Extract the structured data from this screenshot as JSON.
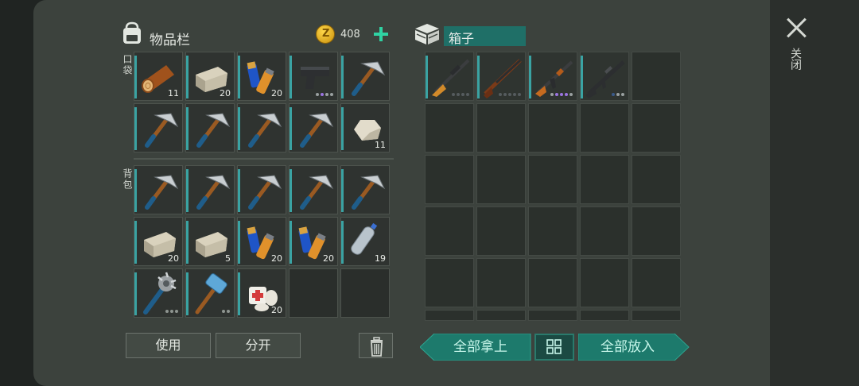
{
  "header": {
    "inventory_title": "物品栏",
    "coin_count": "408",
    "box_title": "箱子"
  },
  "labels": {
    "pocket": "口袋",
    "backpack": "背包",
    "close": "关闭"
  },
  "buttons": {
    "use": "使用",
    "split": "分开",
    "take_all": "全部拿上",
    "put_all": "全部放入"
  },
  "pocket": [
    {
      "item": "log",
      "count": "11"
    },
    {
      "item": "stone-block",
      "count": "20"
    },
    {
      "item": "batteries",
      "count": "20"
    },
    {
      "item": "pistol",
      "count": "",
      "rarity": [
        "#9aa0a0",
        "#9b74e0",
        "#9aa0a0",
        "#9aa0a0"
      ]
    },
    {
      "item": "pickaxe",
      "count": ""
    },
    {
      "item": "pickaxe",
      "count": ""
    },
    {
      "item": "pickaxe",
      "count": ""
    },
    {
      "item": "pickaxe",
      "count": ""
    },
    {
      "item": "pickaxe",
      "count": ""
    },
    {
      "item": "rock",
      "count": "11"
    }
  ],
  "backpack": [
    {
      "item": "pickaxe",
      "count": ""
    },
    {
      "item": "pickaxe",
      "count": ""
    },
    {
      "item": "pickaxe",
      "count": ""
    },
    {
      "item": "pickaxe",
      "count": ""
    },
    {
      "item": "pickaxe",
      "count": ""
    },
    {
      "item": "stone-block",
      "count": "20"
    },
    {
      "item": "stone-block",
      "count": "5"
    },
    {
      "item": "batteries",
      "count": "20"
    },
    {
      "item": "batteries",
      "count": "20"
    },
    {
      "item": "water-bottle",
      "count": "19"
    },
    {
      "item": "spiked-club",
      "count": ""
    },
    {
      "item": "hammer",
      "count": ""
    },
    {
      "item": "bandage",
      "count": "20"
    },
    {
      "item": "empty",
      "count": ""
    },
    {
      "item": "empty",
      "count": ""
    }
  ],
  "box": [
    {
      "item": "hunting-rifle"
    },
    {
      "item": "shotgun"
    },
    {
      "item": "assault-rifle"
    },
    {
      "item": "m16-rifle"
    }
  ],
  "colors": {
    "accent": "#2fd2a3",
    "teal_button": "#1d7a6c",
    "slot_bar": "#3aa3a3"
  }
}
